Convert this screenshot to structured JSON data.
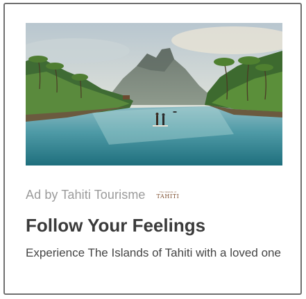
{
  "ad": {
    "sponsor_label": "Ad by Tahiti Tourisme",
    "logo_text": "TAHITI",
    "logo_tagline": "The Islands of",
    "headline": "Follow Your Feelings",
    "description": "Experience The Islands of Tahiti with a loved one",
    "image_icon": "tropical-lagoon-photo"
  },
  "colors": {
    "border": "#6f6f6f",
    "sponsor_text": "#9b9b9b",
    "headline": "#3a3a3a",
    "description": "#444444",
    "logo": "#7a4a2a"
  }
}
